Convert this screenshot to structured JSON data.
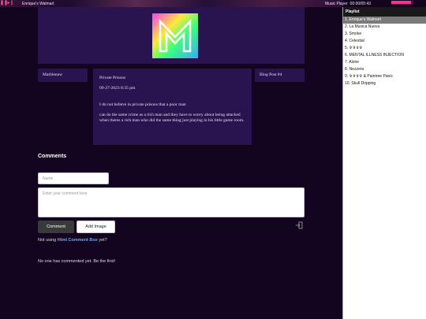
{
  "player": {
    "now_playing": "Enrique's Walmart",
    "player_name": "Music Player",
    "time": "00:00/00:43",
    "progress": 0.9,
    "accent": "#ff2d95"
  },
  "playlist": {
    "title": "Playlist",
    "items": [
      "1. Enrique's Walmart",
      "2. La Musica Nueva",
      "3. Smoke",
      "4. Celestial",
      "5. ✞✞✞✞",
      "6. MENTAL ILLNESS INJECTION",
      "7. Alone",
      "8. Nezzera",
      "9. ✞✞✞✞ & Paintree Panic",
      "10. Skull Dripping"
    ],
    "active_index": 0
  },
  "post": {
    "author": "Marblenaw",
    "title": "Private Prisons",
    "date": "09-27-2023 8:35 pm",
    "body_line1": "I do not believe in private prisons that a poor man",
    "body_line2": "can do the same crime as a rich man and they have to worry about being attacked when theres a rich man who did the same thing just playing in his little game room.",
    "label": "Blog Post #4"
  },
  "comments": {
    "title": "Comments",
    "name_placeholder": "Name",
    "comment_placeholder": "Enter your comment here",
    "comment_button": "Comment",
    "add_image_button": "Add Image",
    "not_using_prefix": "Not using",
    "not_using_link": "Html Comment Box",
    "not_using_suffix": "yet?",
    "empty_message": "No one has commented yet. Be the first!"
  }
}
